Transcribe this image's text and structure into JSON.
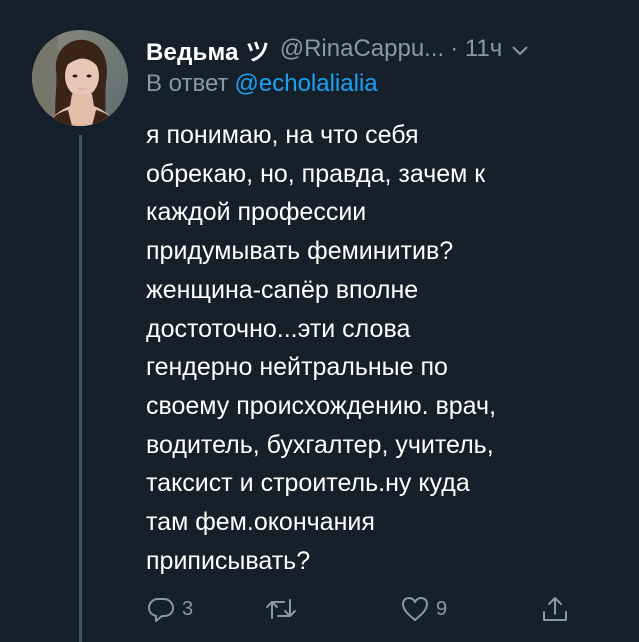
{
  "tweet": {
    "display_name": "Ведьма ツ",
    "handle": "@RinaCappu...",
    "separator_time": "· 11ч",
    "reply_prefix": "В ответ",
    "reply_to": "@echolalialia",
    "text_lines": [
      "я понимаю, на что себя",
      "обрекаю, но, правда, зачем к",
      "каждой профессии",
      "придумывать феминитив?",
      "женщина-сапёр вполне",
      "достоточно...эти слова",
      "гендерно нейтральные по",
      "своему происхождению. врач,",
      "водитель, бухгалтер, учитель,",
      "таксист и строитель.ну куда",
      "там фем.окончания",
      "приписывать?"
    ]
  },
  "actions": {
    "reply_count": "3",
    "retweet_count": "",
    "like_count": "9"
  },
  "colors": {
    "background": "#15202b",
    "text": "#ffffff",
    "muted": "#8899a6",
    "link": "#1da1f2",
    "thread_line": "#3d5466"
  },
  "icons": [
    "reply-icon",
    "retweet-icon",
    "like-icon",
    "share-icon",
    "chevron-down-icon"
  ]
}
